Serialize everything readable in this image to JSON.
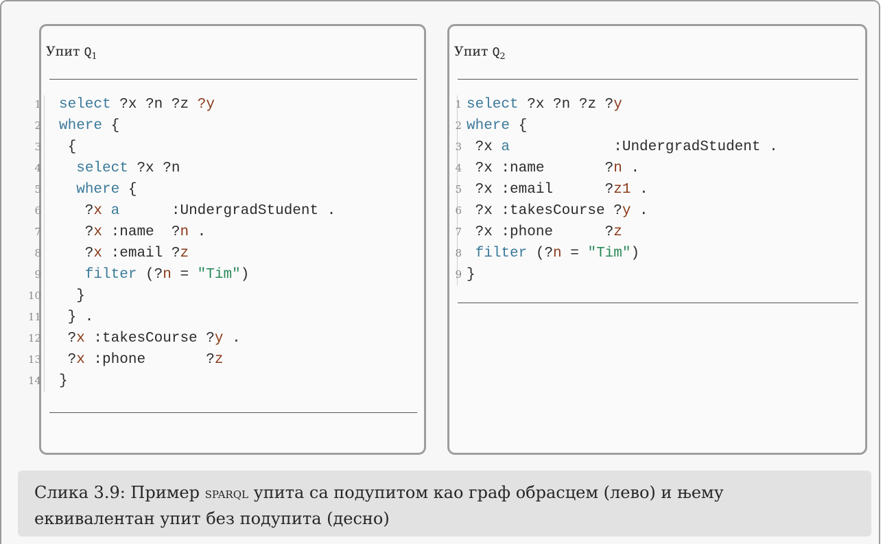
{
  "left_panel": {
    "title": "Упит ",
    "symbol": "Q",
    "subscript": "1",
    "lines": [
      {
        "n": "1",
        "parts": [
          {
            "t": "select",
            "c": "kw"
          },
          {
            "t": " "
          },
          {
            "t": "?x",
            "c": "plain"
          },
          {
            "t": " "
          },
          {
            "t": "?n",
            "c": "plain"
          },
          {
            "t": " "
          },
          {
            "t": "?z",
            "c": "plain"
          },
          {
            "t": " "
          },
          {
            "t": "?y",
            "c": "var"
          }
        ]
      },
      {
        "n": "2",
        "parts": [
          {
            "t": "where",
            "c": "kw"
          },
          {
            "t": " {"
          }
        ]
      },
      {
        "n": "3",
        "parts": [
          {
            "t": " {"
          }
        ]
      },
      {
        "n": "4",
        "parts": [
          {
            "t": "  "
          },
          {
            "t": "select",
            "c": "kw"
          },
          {
            "t": " ?x ?n"
          }
        ]
      },
      {
        "n": "5",
        "parts": [
          {
            "t": "  "
          },
          {
            "t": "where",
            "c": "kw"
          },
          {
            "t": " {"
          }
        ]
      },
      {
        "n": "6",
        "parts": [
          {
            "t": "   ?"
          },
          {
            "t": "x",
            "c": "var"
          },
          {
            "t": " "
          },
          {
            "t": "a",
            "c": "kw"
          },
          {
            "t": "      :UndergradStudent ."
          }
        ]
      },
      {
        "n": "7",
        "parts": [
          {
            "t": "   ?"
          },
          {
            "t": "x",
            "c": "var"
          },
          {
            "t": " :name  ?"
          },
          {
            "t": "n",
            "c": "var"
          },
          {
            "t": " ."
          }
        ]
      },
      {
        "n": "8",
        "parts": [
          {
            "t": "   ?"
          },
          {
            "t": "x",
            "c": "var"
          },
          {
            "t": " :email ?"
          },
          {
            "t": "z",
            "c": "var"
          }
        ]
      },
      {
        "n": "9",
        "parts": [
          {
            "t": "   "
          },
          {
            "t": "filter",
            "c": "kw"
          },
          {
            "t": " (?"
          },
          {
            "t": "n",
            "c": "var"
          },
          {
            "t": " = "
          },
          {
            "t": "\"Tim\"",
            "c": "str"
          },
          {
            "t": ")"
          }
        ]
      },
      {
        "n": "10",
        "parts": [
          {
            "t": "  }"
          }
        ]
      },
      {
        "n": "11",
        "parts": [
          {
            "t": " } ."
          }
        ]
      },
      {
        "n": "12",
        "parts": [
          {
            "t": " ?"
          },
          {
            "t": "x",
            "c": "var"
          },
          {
            "t": " :takesCourse ?"
          },
          {
            "t": "y",
            "c": "var"
          },
          {
            "t": " ."
          }
        ]
      },
      {
        "n": "13",
        "parts": [
          {
            "t": " ?"
          },
          {
            "t": "x",
            "c": "var"
          },
          {
            "t": " :phone       ?"
          },
          {
            "t": "z",
            "c": "var"
          }
        ]
      },
      {
        "n": "14",
        "parts": [
          {
            "t": "}"
          }
        ]
      }
    ]
  },
  "right_panel": {
    "title": "Упит ",
    "symbol": "Q",
    "subscript": "2",
    "lines": [
      {
        "n": "1",
        "parts": [
          {
            "t": "select",
            "c": "kw"
          },
          {
            "t": " ?x ?n ?z ?"
          },
          {
            "t": "y",
            "c": "var"
          }
        ]
      },
      {
        "n": "2",
        "parts": [
          {
            "t": "where",
            "c": "kw"
          },
          {
            "t": " {"
          }
        ]
      },
      {
        "n": "3",
        "parts": [
          {
            "t": " ?x "
          },
          {
            "t": "a",
            "c": "kw"
          },
          {
            "t": "            :UndergradStudent ."
          }
        ]
      },
      {
        "n": "4",
        "parts": [
          {
            "t": " ?x :name       ?"
          },
          {
            "t": "n",
            "c": "var"
          },
          {
            "t": " ."
          }
        ]
      },
      {
        "n": "5",
        "parts": [
          {
            "t": " ?x :email      ?"
          },
          {
            "t": "z1",
            "c": "var"
          },
          {
            "t": " ."
          }
        ]
      },
      {
        "n": "6",
        "parts": [
          {
            "t": " ?x :takesCourse ?"
          },
          {
            "t": "y",
            "c": "var"
          },
          {
            "t": " ."
          }
        ]
      },
      {
        "n": "7",
        "parts": [
          {
            "t": " ?x :phone      ?"
          },
          {
            "t": "z",
            "c": "var"
          }
        ]
      },
      {
        "n": "8",
        "parts": [
          {
            "t": " "
          },
          {
            "t": "filter",
            "c": "kw"
          },
          {
            "t": " (?"
          },
          {
            "t": "n",
            "c": "var"
          },
          {
            "t": " = "
          },
          {
            "t": "\"Tim\"",
            "c": "str"
          },
          {
            "t": ")"
          }
        ]
      },
      {
        "n": "9",
        "parts": [
          {
            "t": "}"
          }
        ]
      }
    ]
  },
  "caption": {
    "prefix": "Слика 3.9: Пример ",
    "sparql": "sparql",
    "line1_rest": " упита са подупитом као граф обрасцем (лево) и њему",
    "line2": "еквивалентан упит без подупита (десно)"
  }
}
